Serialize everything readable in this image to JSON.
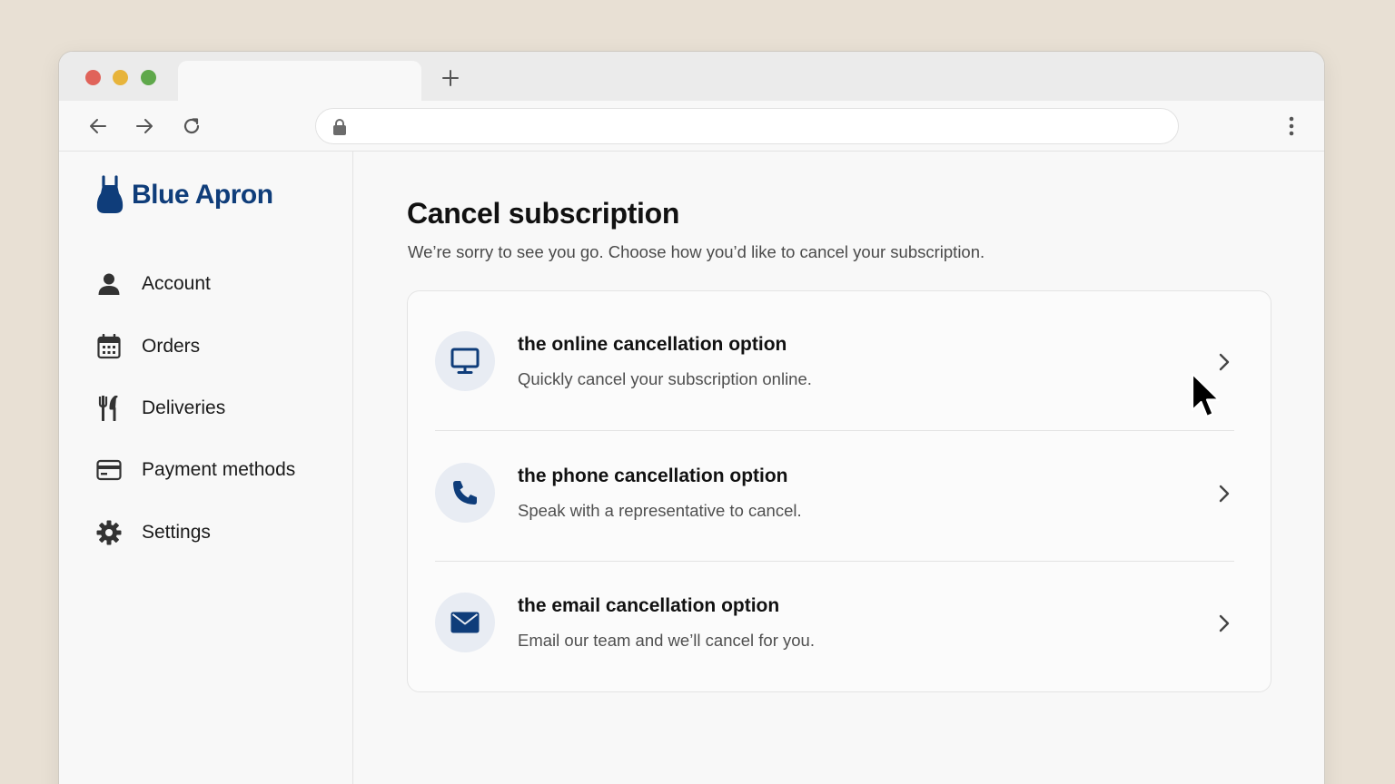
{
  "browser": {
    "tab_title": "",
    "new_tab_label": "+",
    "url": ""
  },
  "brand": {
    "name": "Blue Apron",
    "color": "#0f3d7a"
  },
  "sidebar": {
    "items": [
      {
        "label": "Account",
        "icon": "person-icon"
      },
      {
        "label": "Orders",
        "icon": "calendar-icon"
      },
      {
        "label": "Deliveries",
        "icon": "fork-knife-icon"
      },
      {
        "label": "Payment methods",
        "icon": "credit-card-icon"
      },
      {
        "label": "Settings",
        "icon": "gear-icon"
      }
    ]
  },
  "main": {
    "title": "Cancel subscription",
    "subtitle": "We’re sorry to see you go. Choose how you’d like to cancel your subscription.",
    "options": [
      {
        "title": "the online cancellation option",
        "description": "Quickly cancel your subscription online.",
        "icon": "monitor-icon"
      },
      {
        "title": "the phone cancellation option",
        "description": "Speak with a representative to cancel.",
        "icon": "phone-icon"
      },
      {
        "title": "the email cancellation option",
        "description": "Email our team and we’ll cancel for you.",
        "icon": "envelope-icon"
      }
    ]
  },
  "colors": {
    "accent": "#0f3d7a",
    "background": "#e8e0d4"
  }
}
